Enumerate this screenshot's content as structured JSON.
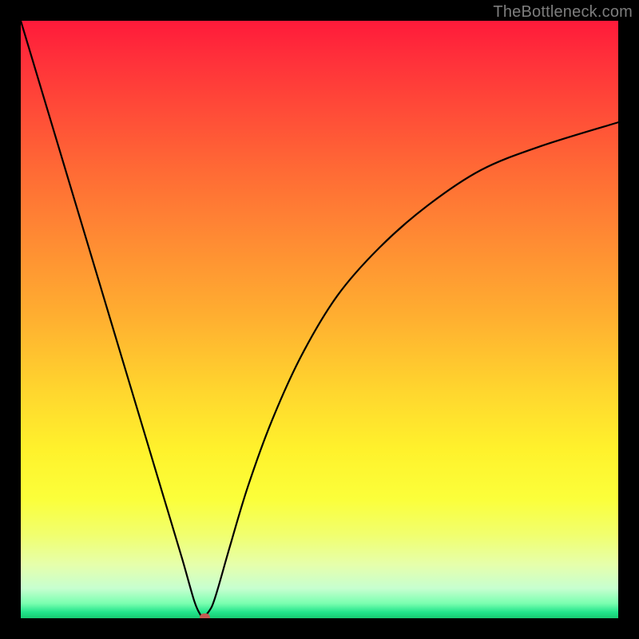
{
  "watermark": "TheBottleneck.com",
  "colors": {
    "frame": "#000000",
    "curve": "#000000",
    "marker": "#c35a52"
  },
  "chart_data": {
    "type": "line",
    "title": "",
    "xlabel": "",
    "ylabel": "",
    "xlim": [
      0,
      100
    ],
    "ylim": [
      0,
      100
    ],
    "grid": false,
    "series": [
      {
        "name": "bottleneck-curve",
        "x": [
          0,
          3,
          6,
          9,
          12,
          15,
          18,
          21,
          24,
          27,
          29,
          30,
          30.8,
          31,
          32,
          33,
          35,
          38,
          42,
          47,
          53,
          60,
          68,
          77,
          87,
          100
        ],
        "values": [
          100,
          90,
          80,
          70,
          60,
          50,
          40,
          30,
          20,
          10,
          3,
          0.7,
          0,
          0.5,
          2,
          5,
          12,
          22,
          33,
          44,
          54,
          62,
          69,
          75,
          79,
          83
        ]
      }
    ],
    "markers": [
      {
        "name": "bottleneck-point",
        "x": 30.8,
        "y": 0
      }
    ],
    "gradient_stops": [
      {
        "pos": 0,
        "color": "#ff1a3a"
      },
      {
        "pos": 0.5,
        "color": "#ffb030"
      },
      {
        "pos": 0.8,
        "color": "#fbff3a"
      },
      {
        "pos": 0.97,
        "color": "#7bffb0"
      },
      {
        "pos": 1.0,
        "color": "#18c971"
      }
    ]
  }
}
